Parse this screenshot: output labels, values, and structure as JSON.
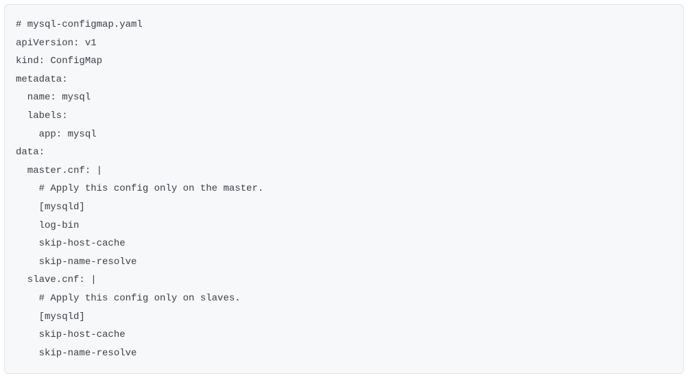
{
  "code": {
    "lines": [
      "# mysql-configmap.yaml",
      "apiVersion: v1",
      "kind: ConfigMap",
      "metadata:",
      "  name: mysql",
      "  labels:",
      "    app: mysql",
      "data:",
      "  master.cnf: |",
      "    # Apply this config only on the master.",
      "    [mysqld]",
      "    log-bin",
      "    skip-host-cache",
      "    skip-name-resolve",
      "  slave.cnf: |",
      "    # Apply this config only on slaves.",
      "    [mysqld]",
      "    skip-host-cache",
      "    skip-name-resolve"
    ]
  }
}
